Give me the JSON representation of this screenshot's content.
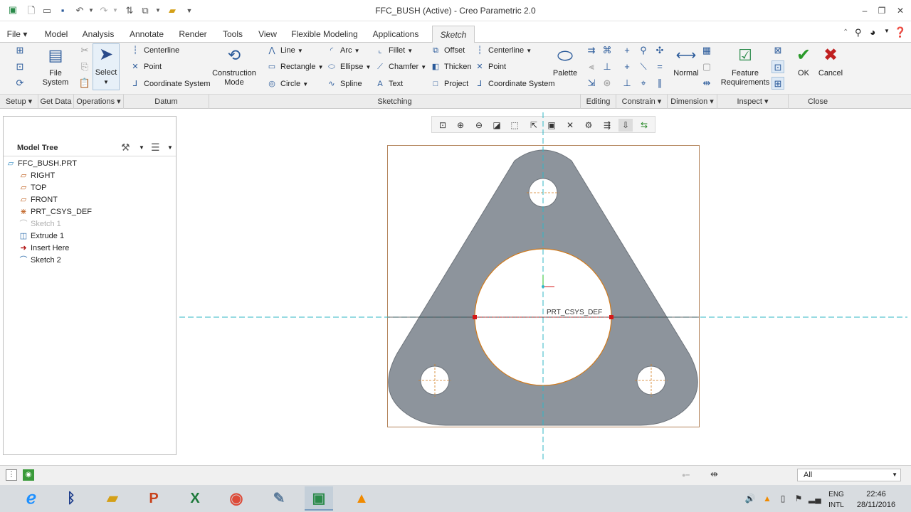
{
  "window": {
    "title": "FFC_BUSH (Active) - Creo Parametric 2.0"
  },
  "tabs": [
    {
      "label": "File"
    },
    {
      "label": "Model"
    },
    {
      "label": "Analysis"
    },
    {
      "label": "Annotate"
    },
    {
      "label": "Render"
    },
    {
      "label": "Tools"
    },
    {
      "label": "View"
    },
    {
      "label": "Flexible Modeling"
    },
    {
      "label": "Applications"
    },
    {
      "label": "Sketch"
    }
  ],
  "ribbon": {
    "file_system": "File\nSystem",
    "select": "Select",
    "datum": {
      "centerline": "Centerline",
      "point": "Point",
      "coordinate_system": "Coordinate System"
    },
    "construction_mode": "Construction\nMode",
    "sketching": {
      "line": "Line",
      "rectangle": "Rectangle",
      "circle": "Circle",
      "arc": "Arc",
      "ellipse": "Ellipse",
      "spline": "Spline",
      "fillet": "Fillet",
      "chamfer": "Chamfer",
      "text": "Text",
      "offset": "Offset",
      "thicken": "Thicken",
      "project": "Project",
      "centerline": "Centerline",
      "point": "Point",
      "coordinate_system": "Coordinate System"
    },
    "palette": "Palette",
    "normal": "Normal",
    "feature_requirements": "Feature\nRequirements",
    "ok": "OK",
    "cancel": "Cancel",
    "groups": [
      "Setup",
      "Get Data",
      "Operations",
      "Datum",
      "Sketching",
      "Editing",
      "Constrain",
      "Dimension",
      "Inspect",
      "Close"
    ]
  },
  "model_tree": {
    "title": "Model Tree",
    "items": [
      {
        "label": "FFC_BUSH.PRT",
        "icon": "part-icon"
      },
      {
        "label": "RIGHT",
        "icon": "datum-plane-icon"
      },
      {
        "label": "TOP",
        "icon": "datum-plane-icon"
      },
      {
        "label": "FRONT",
        "icon": "datum-plane-icon"
      },
      {
        "label": "PRT_CSYS_DEF",
        "icon": "csys-icon"
      },
      {
        "label": "Sketch 1",
        "icon": "sketch-icon"
      },
      {
        "label": "Extrude 1",
        "icon": "extrude-icon"
      },
      {
        "label": "Insert Here",
        "icon": "insert-arrow-icon"
      },
      {
        "label": "Sketch 2",
        "icon": "sketch-icon"
      }
    ]
  },
  "canvas": {
    "csys_label": "PRT_CSYS_DEF"
  },
  "status": {
    "filter_value": "All"
  },
  "taskbar": {
    "lang_line1": "ENG",
    "lang_line2": "INTL",
    "time": "22:46",
    "date": "28/11/2016"
  },
  "colors": {
    "part_fill": "#8d949c",
    "centerline": "#30b7c6",
    "sketch_edge": "#d27a1a",
    "ok_green": "#2a9a2a",
    "cancel_red": "#c02020"
  }
}
